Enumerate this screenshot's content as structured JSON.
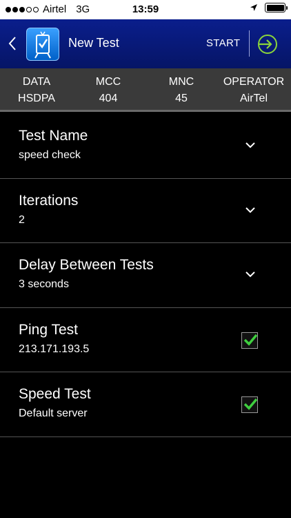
{
  "status_bar": {
    "carrier": "Airtel",
    "network": "3G",
    "time": "13:59",
    "signal_bars": 3,
    "signal_total": 5
  },
  "nav": {
    "back_icon": "chevron-left-icon",
    "title": "New Test",
    "start_label": "START",
    "run_icon": "arrow-circle-right-icon"
  },
  "info": {
    "data": {
      "label": "DATA",
      "value": "HSDPA"
    },
    "mcc": {
      "label": "MCC",
      "value": "404"
    },
    "mnc": {
      "label": "MNC",
      "value": "45"
    },
    "operator": {
      "label": "OPERATOR",
      "value": "AirTel"
    }
  },
  "settings": {
    "test_name": {
      "title": "Test Name",
      "value": "speed check"
    },
    "iterations": {
      "title": "Iterations",
      "value": "2"
    },
    "delay": {
      "title": "Delay Between Tests",
      "value": "3 seconds"
    },
    "ping": {
      "title": "Ping Test",
      "value": "213.171.193.5",
      "checked": true
    },
    "speed": {
      "title": "Speed Test",
      "value": "Default server",
      "checked": true
    }
  },
  "colors": {
    "nav_bg": "#0a1e8c",
    "info_bg": "#3a3a3a",
    "check_green": "#3fcf3f",
    "run_icon_green": "#8bd43a"
  }
}
